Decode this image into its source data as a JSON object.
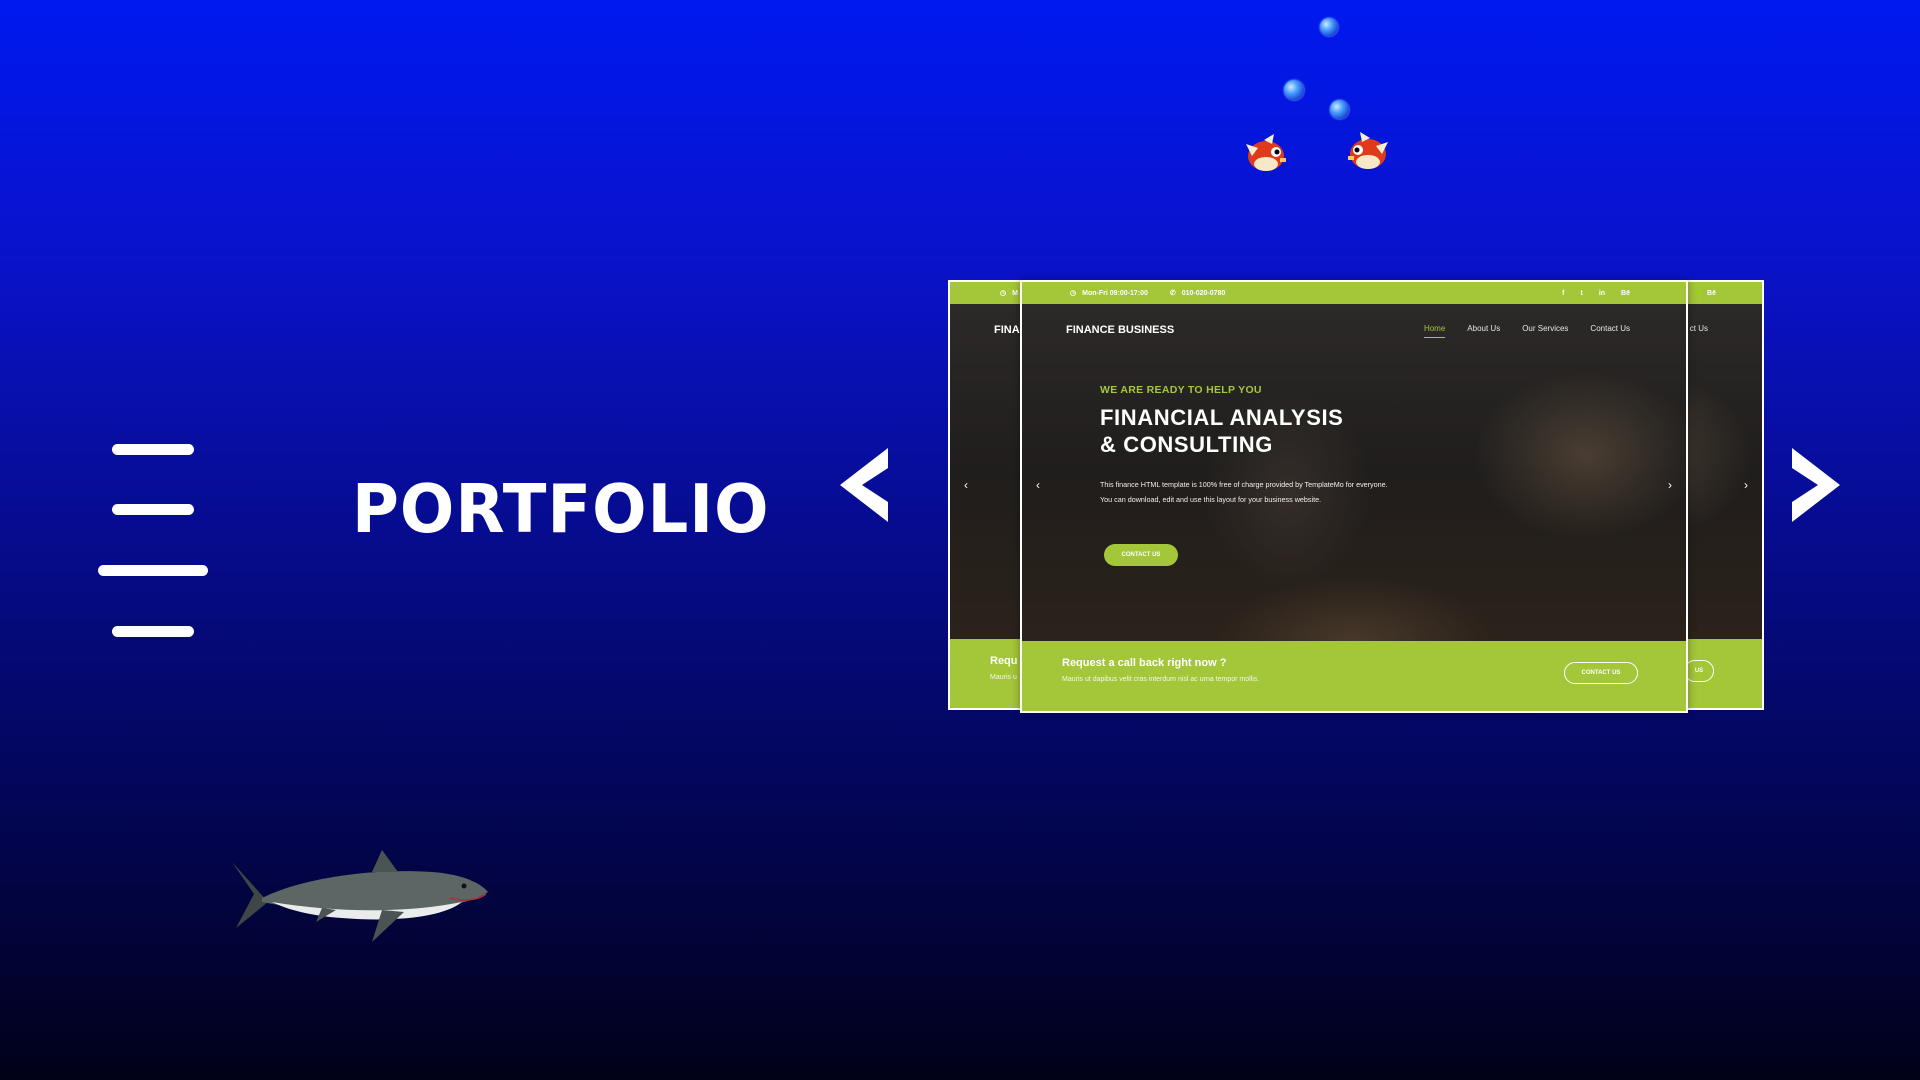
{
  "page": {
    "title": "PORTFOLIO"
  },
  "nav_arrows": {
    "prev": "<",
    "next": ">"
  },
  "slide": {
    "topbar": {
      "hours": "Mon-Fri 09:00-17:00",
      "phone": "010-020-0780",
      "social": [
        "f",
        "t",
        "in",
        "Bē"
      ]
    },
    "brand": "FINANCE BUSINESS",
    "nav": [
      "Home",
      "About Us",
      "Our Services",
      "Contact Us"
    ],
    "eyebrow": "WE ARE READY TO HELP YOU",
    "headline_line1": "FINANCIAL ANALYSIS",
    "headline_line2": "& CONSULTING",
    "description": "This finance HTML template is 100% free of charge provided by TemplateMo for everyone. You can download, edit and use this layout for your business website.",
    "cta": "CONTACT US",
    "prev_arrow": "‹",
    "next_arrow": "›",
    "footer": {
      "title": "Request a call back right now ?",
      "subtitle": "Mauris ut dapibus velit cras interdum nisl ac urna tempor mollis.",
      "button": "CONTACT US"
    }
  },
  "back_slide": {
    "brand_fragment": "FINA",
    "footer_fragment": "Requ",
    "footer_sub_fragment": "Mauris u",
    "nav_fragment": "ct Us",
    "button_fragment": "US",
    "social_fragment": "Bē",
    "topbar_fragment": "M"
  },
  "colors": {
    "accent": "#a4c639",
    "bg_top": "#0019f0",
    "bg_bottom": "#010118"
  }
}
